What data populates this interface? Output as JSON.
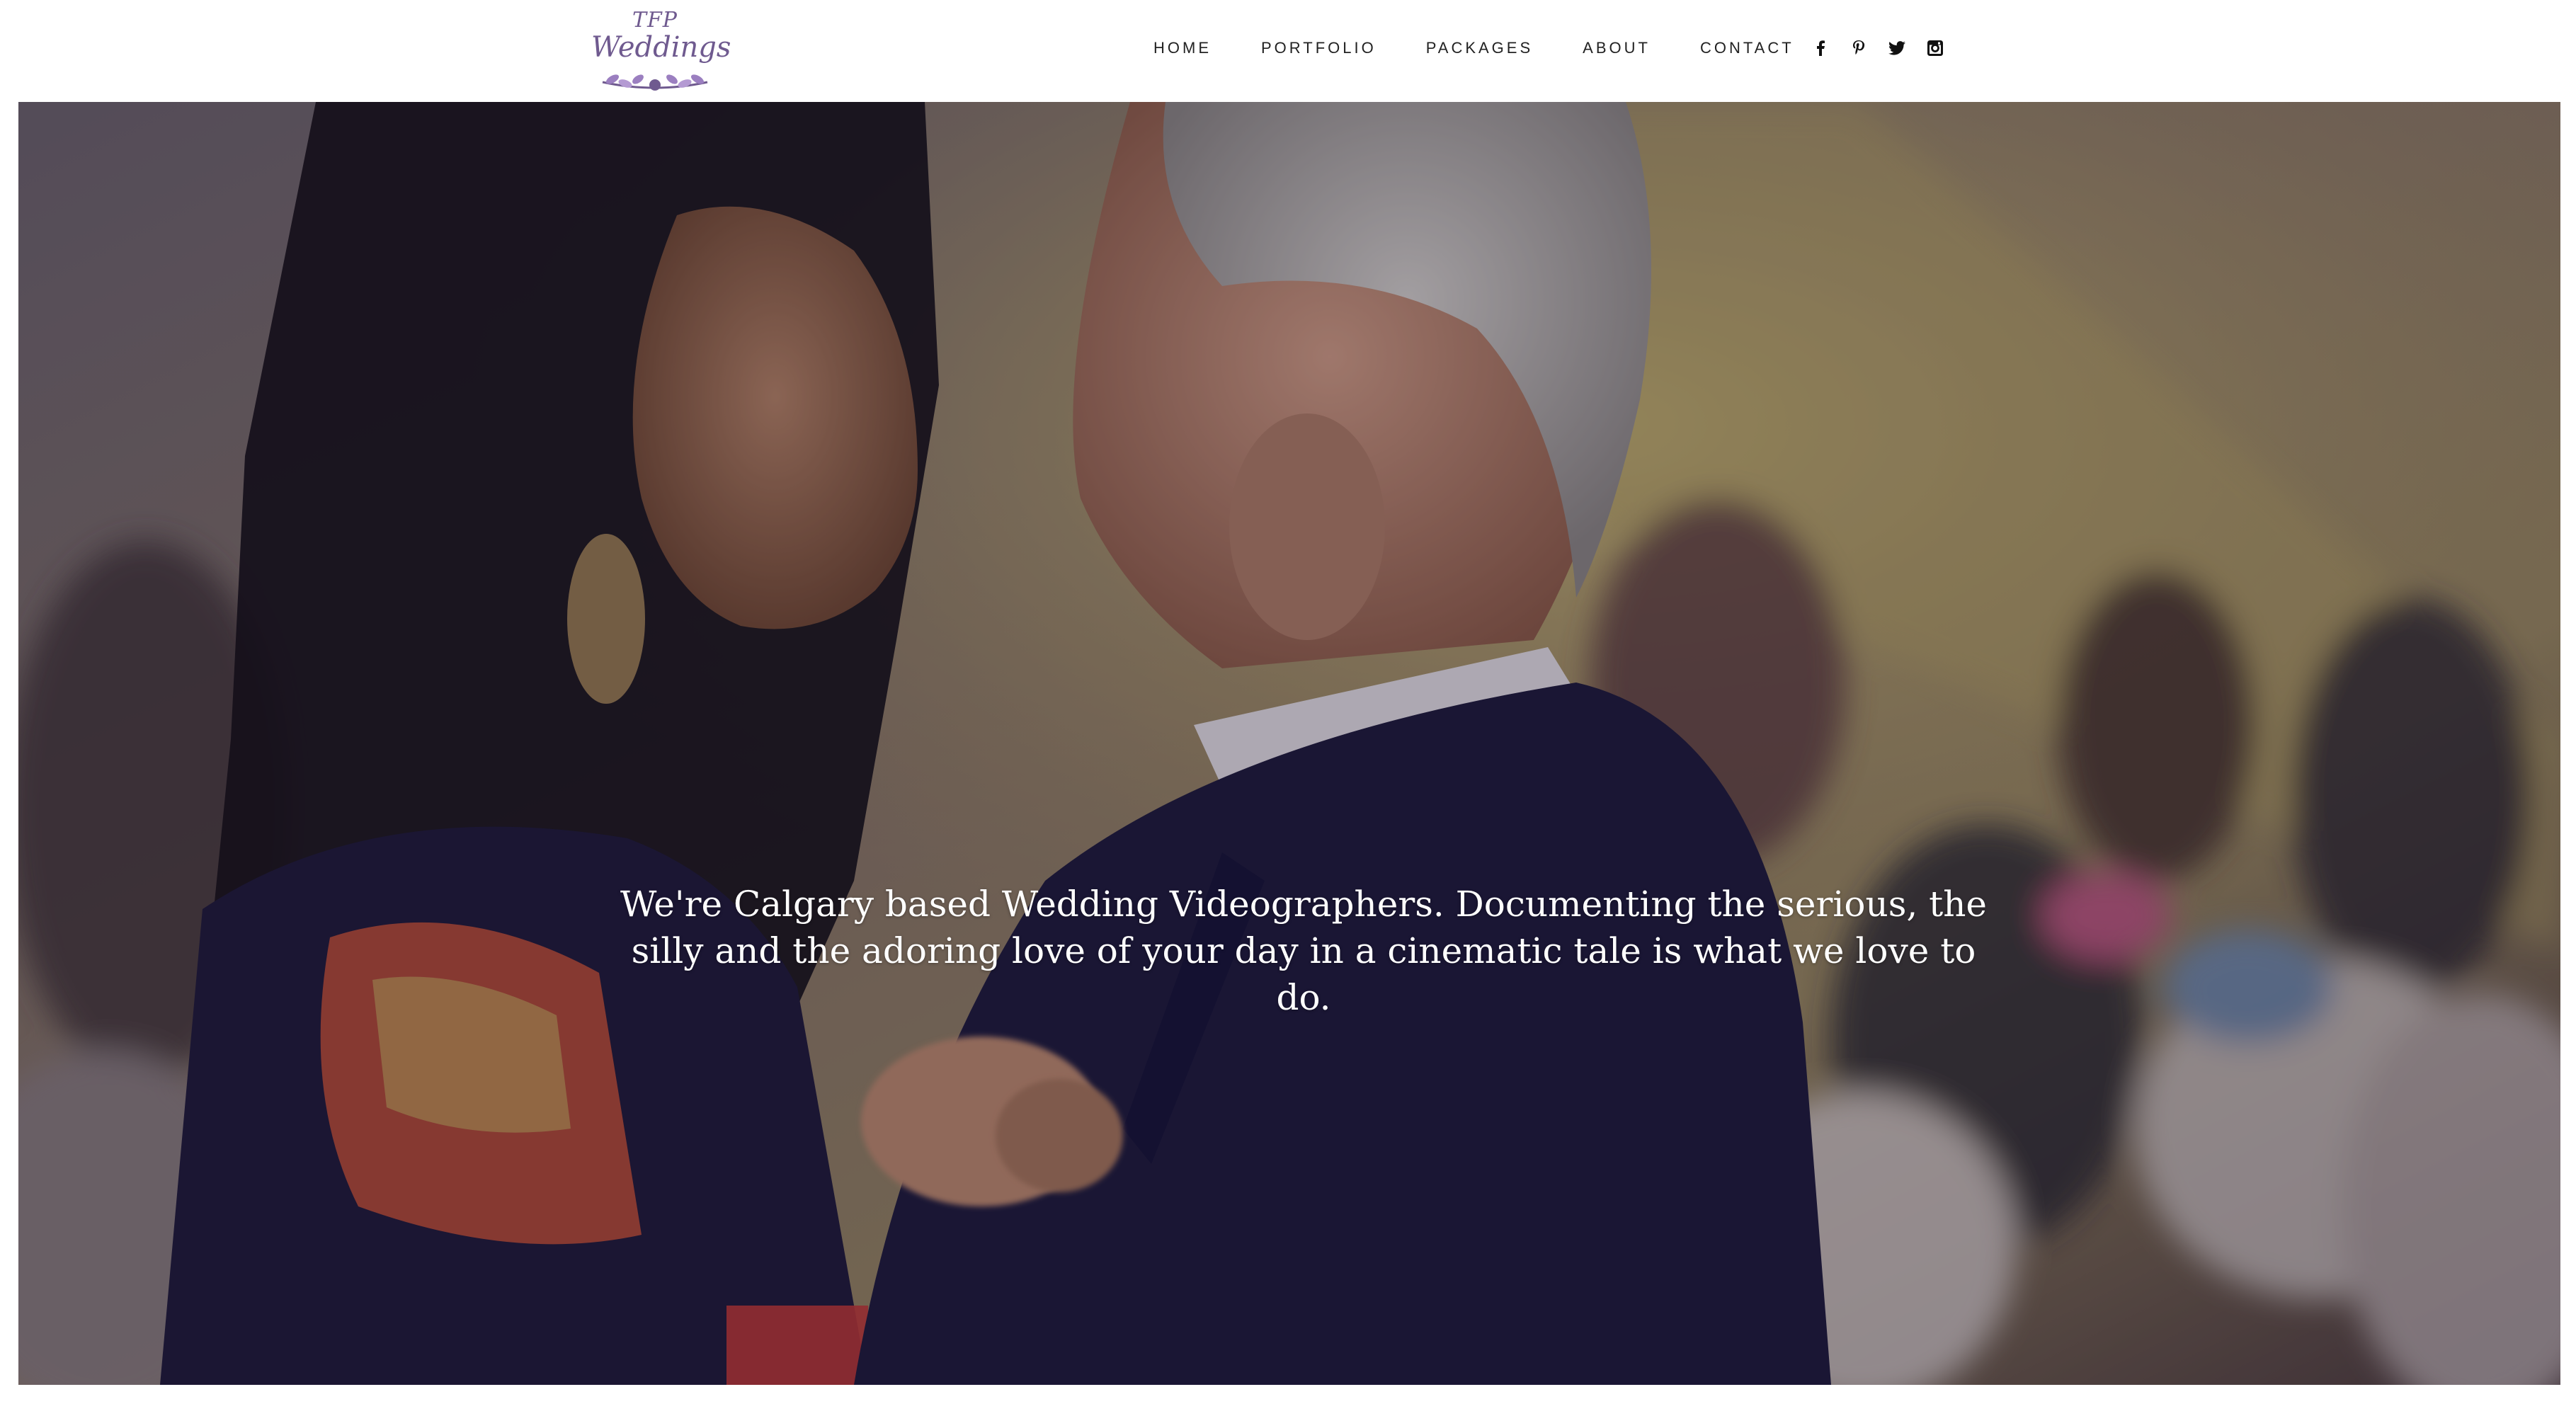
{
  "brand": {
    "logo_top": "TFP",
    "logo_main": "Weddings",
    "colors": {
      "logo": "#6f5a8f",
      "leaf": "#9b7fc0"
    }
  },
  "nav": {
    "items": [
      {
        "label": "HOME"
      },
      {
        "label": "PORTFOLIO"
      },
      {
        "label": "PACKAGES"
      },
      {
        "label": "ABOUT"
      },
      {
        "label": "CONTACT"
      }
    ]
  },
  "social": {
    "icons": [
      "facebook-icon",
      "pinterest-icon",
      "twitter-icon",
      "instagram-icon"
    ]
  },
  "hero": {
    "tagline": "We're Calgary based Wedding Videographers. Documenting the serious, the silly and the adoring love of your day in a cinematic tale is what we love to do."
  }
}
